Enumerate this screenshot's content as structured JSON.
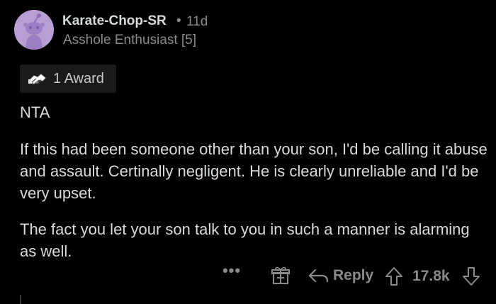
{
  "author": {
    "username": "Karate-Chop-SR",
    "separator": "•",
    "time_ago": "11d",
    "flair": "Asshole Enthusiast [5]",
    "avatar_color": "#b79fd4"
  },
  "award": {
    "icon": "helping-hand-award-icon",
    "label": "1 Award"
  },
  "body": {
    "paragraphs": [
      "NTA",
      "If this had been someone other than your son, I'd be calling it abuse and assault. Certinally negligent. He is clearly unreliable and I'd be very upset.",
      "The fact you let your son talk to you in such a manner is alarming as well."
    ]
  },
  "actions": {
    "more_label": "•••",
    "gift_icon": "gift-icon",
    "reply_icon": "reply-arrow-icon",
    "reply_label": "Reply",
    "upvote_icon": "upvote-arrow-icon",
    "score": "17.8k",
    "downvote_icon": "downvote-arrow-icon"
  },
  "colors": {
    "background": "#000000",
    "text": "#d7dadc",
    "muted": "#8a8a8a",
    "badge_bg": "#1a1a1b"
  }
}
